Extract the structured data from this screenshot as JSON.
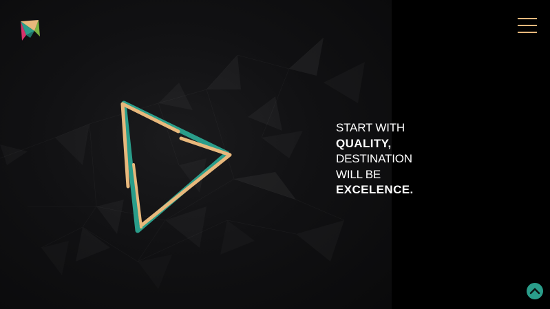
{
  "brand": {
    "logo_icon": "kite-logo-icon",
    "colors": {
      "teal": "#2a9d8a",
      "orange": "#e8b87c",
      "magenta": "#d6336c",
      "green": "#7cb342"
    }
  },
  "header": {
    "menu_icon": "hamburger-menu-icon"
  },
  "hero": {
    "graphic_icon": "play-triangle-icon",
    "headline": {
      "line1": "START WITH",
      "line2": "QUALITY,",
      "line3": "DESTINATION",
      "line4": "WILL BE",
      "line5": "EXCELENCE."
    }
  },
  "footer": {
    "scroll_top_icon": "chevron-up-icon"
  }
}
